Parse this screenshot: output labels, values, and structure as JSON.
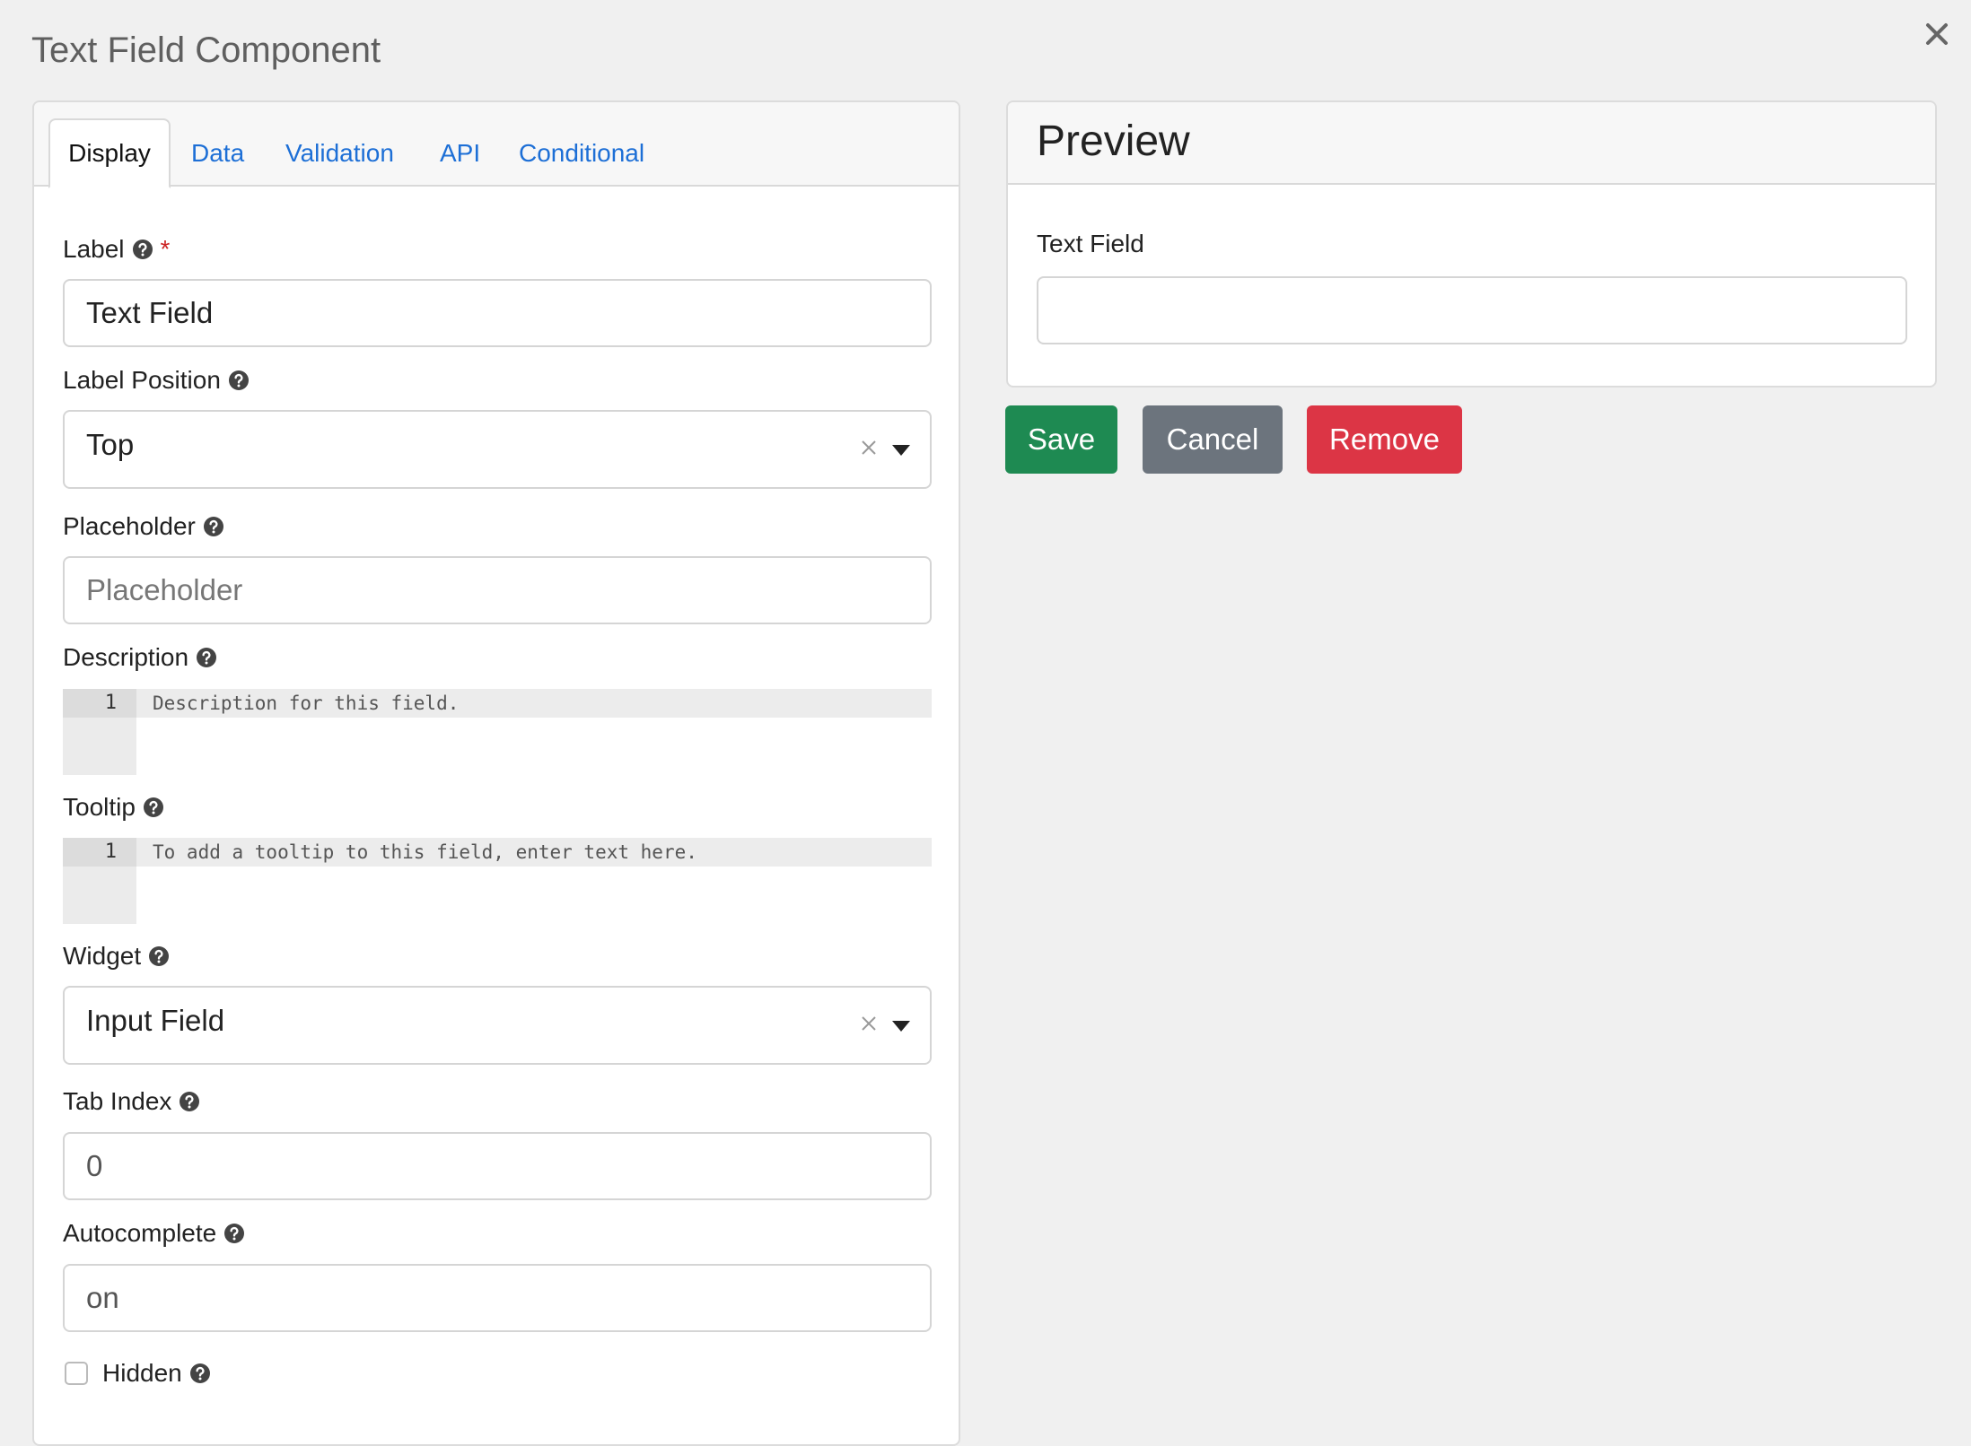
{
  "modal": {
    "title": "Text Field Component"
  },
  "tabs": [
    {
      "label": "Display",
      "active": true
    },
    {
      "label": "Data",
      "active": false
    },
    {
      "label": "Validation",
      "active": false
    },
    {
      "label": "API",
      "active": false
    },
    {
      "label": "Conditional",
      "active": false
    }
  ],
  "form": {
    "label": {
      "label": "Label",
      "required_mark": "*",
      "value": "Text Field"
    },
    "label_position": {
      "label": "Label Position",
      "value": "Top"
    },
    "placeholder": {
      "label": "Placeholder",
      "placeholder": "Placeholder"
    },
    "description": {
      "label": "Description",
      "line_number": "1",
      "text": "Description for this field."
    },
    "tooltip": {
      "label": "Tooltip",
      "line_number": "1",
      "text": "To add a tooltip to this field, enter text here."
    },
    "widget": {
      "label": "Widget",
      "value": "Input Field"
    },
    "tab_index": {
      "label": "Tab Index",
      "value": "0"
    },
    "autocomplete": {
      "label": "Autocomplete",
      "value": "on"
    },
    "hidden": {
      "label": "Hidden",
      "checked": false
    }
  },
  "preview": {
    "title": "Preview",
    "field_label": "Text Field",
    "field_value": ""
  },
  "actions": {
    "save": "Save",
    "cancel": "Cancel",
    "remove": "Remove"
  },
  "colors": {
    "link": "#1d6fd6",
    "save": "#1e8a52",
    "cancel": "#6c747d",
    "remove": "#dc3545",
    "required": "#cc2323",
    "background": "#f0f0f0"
  },
  "icons": {
    "help": "question-circle-icon",
    "close": "close-icon",
    "clear": "clear-icon",
    "caret": "caret-down-icon"
  }
}
